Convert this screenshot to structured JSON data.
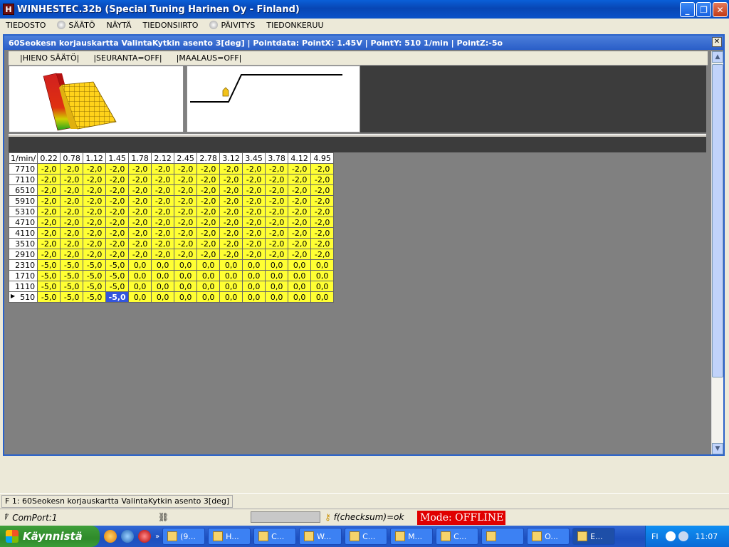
{
  "window": {
    "title": "WINHESTEC.32b (Special Tuning Harinen Oy - Finland)",
    "icon_letter": "H"
  },
  "menu": [
    "TIEDOSTO",
    "SÄÄTÖ",
    "NÄYTÄ",
    "TIEDONSIIRTO",
    "PÄIVITYS",
    "TIEDONKERUU"
  ],
  "child": {
    "title": "60Seokesn korjauskartta ValintaKytkin asento 3[deg] | Pointdata: PointX: 1.45V | PointY: 510 1/min | PointZ:-5o",
    "toolbar": [
      "|HIENO SÄÄTÖ|",
      "|SEURANTA=OFF|",
      "|MAALAUS=OFF|"
    ]
  },
  "table": {
    "corner": "1/min/",
    "columns": [
      "0.22",
      "0.78",
      "1.12",
      "1.45",
      "1.78",
      "2.12",
      "2.45",
      "2.78",
      "3.12",
      "3.45",
      "3.78",
      "4.12",
      "4.95"
    ],
    "rows": [
      {
        "rpm": "7710",
        "values": [
          "-2,0",
          "-2,0",
          "-2,0",
          "-2,0",
          "-2,0",
          "-2,0",
          "-2,0",
          "-2,0",
          "-2,0",
          "-2,0",
          "-2,0",
          "-2,0",
          "-2,0"
        ]
      },
      {
        "rpm": "7110",
        "values": [
          "-2,0",
          "-2,0",
          "-2,0",
          "-2,0",
          "-2,0",
          "-2,0",
          "-2,0",
          "-2,0",
          "-2,0",
          "-2,0",
          "-2,0",
          "-2,0",
          "-2,0"
        ]
      },
      {
        "rpm": "6510",
        "values": [
          "-2,0",
          "-2,0",
          "-2,0",
          "-2,0",
          "-2,0",
          "-2,0",
          "-2,0",
          "-2,0",
          "-2,0",
          "-2,0",
          "-2,0",
          "-2,0",
          "-2,0"
        ]
      },
      {
        "rpm": "5910",
        "values": [
          "-2,0",
          "-2,0",
          "-2,0",
          "-2,0",
          "-2,0",
          "-2,0",
          "-2,0",
          "-2,0",
          "-2,0",
          "-2,0",
          "-2,0",
          "-2,0",
          "-2,0"
        ]
      },
      {
        "rpm": "5310",
        "values": [
          "-2,0",
          "-2,0",
          "-2,0",
          "-2,0",
          "-2,0",
          "-2,0",
          "-2,0",
          "-2,0",
          "-2,0",
          "-2,0",
          "-2,0",
          "-2,0",
          "-2,0"
        ]
      },
      {
        "rpm": "4710",
        "values": [
          "-2,0",
          "-2,0",
          "-2,0",
          "-2,0",
          "-2,0",
          "-2,0",
          "-2,0",
          "-2,0",
          "-2,0",
          "-2,0",
          "-2,0",
          "-2,0",
          "-2,0"
        ]
      },
      {
        "rpm": "4110",
        "values": [
          "-2,0",
          "-2,0",
          "-2,0",
          "-2,0",
          "-2,0",
          "-2,0",
          "-2,0",
          "-2,0",
          "-2,0",
          "-2,0",
          "-2,0",
          "-2,0",
          "-2,0"
        ]
      },
      {
        "rpm": "3510",
        "values": [
          "-2,0",
          "-2,0",
          "-2,0",
          "-2,0",
          "-2,0",
          "-2,0",
          "-2,0",
          "-2,0",
          "-2,0",
          "-2,0",
          "-2,0",
          "-2,0",
          "-2,0"
        ]
      },
      {
        "rpm": "2910",
        "values": [
          "-2,0",
          "-2,0",
          "-2,0",
          "-2,0",
          "-2,0",
          "-2,0",
          "-2,0",
          "-2,0",
          "-2,0",
          "-2,0",
          "-2,0",
          "-2,0",
          "-2,0"
        ]
      },
      {
        "rpm": "2310",
        "values": [
          "-5,0",
          "-5,0",
          "-5,0",
          "-5,0",
          "0,0",
          "0,0",
          "0,0",
          "0,0",
          "0,0",
          "0,0",
          "0,0",
          "0,0",
          "0,0"
        ]
      },
      {
        "rpm": "1710",
        "values": [
          "-5,0",
          "-5,0",
          "-5,0",
          "-5,0",
          "0,0",
          "0,0",
          "0,0",
          "0,0",
          "0,0",
          "0,0",
          "0,0",
          "0,0",
          "0,0"
        ]
      },
      {
        "rpm": "1110",
        "values": [
          "-5,0",
          "-5,0",
          "-5,0",
          "-5,0",
          "0,0",
          "0,0",
          "0,0",
          "0,0",
          "0,0",
          "0,0",
          "0,0",
          "0,0",
          "0,0"
        ]
      },
      {
        "rpm": "510",
        "values": [
          "-5,0",
          "-5,0",
          "-5,0",
          "-5,0",
          "0,0",
          "0,0",
          "0,0",
          "0,0",
          "0,0",
          "0,0",
          "0,0",
          "0,0",
          "0,0"
        ]
      }
    ],
    "selected": {
      "row": 12,
      "col": 3
    },
    "colors": {
      "cell": "#ffff33",
      "selected": "#3355dd"
    }
  },
  "status": {
    "page": "F 1:  60Seokesn korjauskartta ValintaKytkin asento 3[deg]",
    "comport": "ComPort:1",
    "checksum": "f(checksum)=ok",
    "mode": "Mode: OFFLINE",
    "mode_color": "#e00000"
  },
  "taskbar": {
    "start": "Käynnistä",
    "buttons": [
      "(9...",
      "H...",
      "C...",
      "W...",
      "C...",
      "M...",
      "C...",
      "",
      "O...",
      "E..."
    ],
    "active_index": 9,
    "lang": "FI",
    "clock": "11:07"
  }
}
